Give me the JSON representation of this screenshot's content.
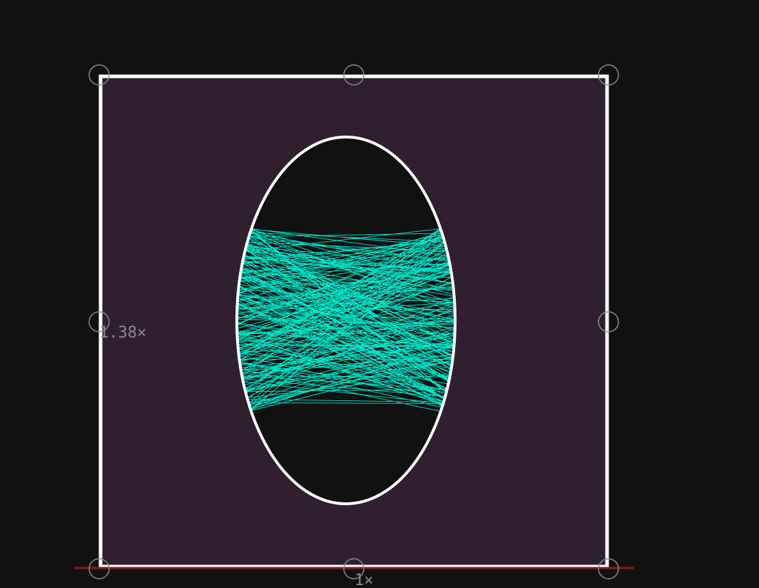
{
  "canvas": {
    "background_color": "#111111",
    "frame_fill_color": "#2f1f2f",
    "frame_stroke_color": "#ffffff",
    "ellipse_stroke_color": "#ffffff",
    "ellipse_fill_color": "#111111",
    "ray_color": "#00ffe0",
    "baseline_color": "#8b1a1a",
    "handle_color": "#8a8a8a",
    "label_color": "#8a8a8a"
  },
  "scale_labels": {
    "vertical": "1.38×",
    "horizontal": "1×"
  },
  "icons": {
    "handle": "circle-handle-icon"
  }
}
